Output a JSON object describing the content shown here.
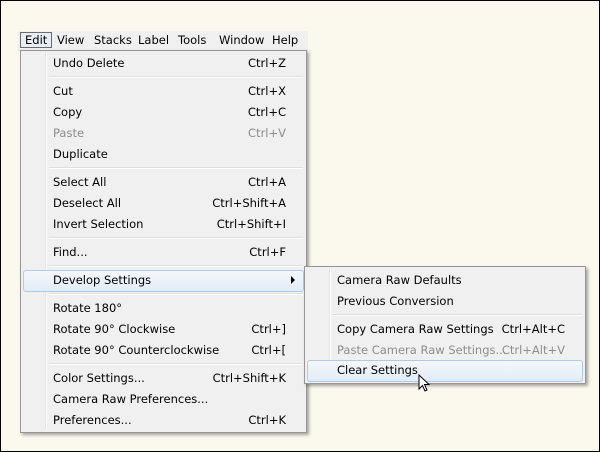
{
  "menubar": {
    "items": [
      "Edit",
      "View",
      "Stacks",
      "Label",
      "Tools",
      "Window",
      "Help"
    ]
  },
  "edit_menu": {
    "undo_delete": {
      "label": "Undo Delete",
      "shortcut": "Ctrl+Z"
    },
    "cut": {
      "label": "Cut",
      "shortcut": "Ctrl+X"
    },
    "copy": {
      "label": "Copy",
      "shortcut": "Ctrl+C"
    },
    "paste": {
      "label": "Paste",
      "shortcut": "Ctrl+V"
    },
    "duplicate": {
      "label": "Duplicate"
    },
    "select_all": {
      "label": "Select All",
      "shortcut": "Ctrl+A"
    },
    "deselect_all": {
      "label": "Deselect All",
      "shortcut": "Ctrl+Shift+A"
    },
    "invert_selection": {
      "label": "Invert Selection",
      "shortcut": "Ctrl+Shift+I"
    },
    "find": {
      "label": "Find...",
      "shortcut": "Ctrl+F"
    },
    "develop_settings": {
      "label": "Develop Settings"
    },
    "rotate_180": {
      "label": "Rotate 180°"
    },
    "rotate_cw": {
      "label": "Rotate 90° Clockwise",
      "shortcut": "Ctrl+]"
    },
    "rotate_ccw": {
      "label": "Rotate 90° Counterclockwise",
      "shortcut": "Ctrl+["
    },
    "color_settings": {
      "label": "Color Settings...",
      "shortcut": "Ctrl+Shift+K"
    },
    "camera_raw_prefs": {
      "label": "Camera Raw Preferences..."
    },
    "preferences": {
      "label": "Preferences...",
      "shortcut": "Ctrl+K"
    }
  },
  "develop_submenu": {
    "camera_raw_defaults": {
      "label": "Camera Raw Defaults"
    },
    "previous_conversion": {
      "label": "Previous Conversion"
    },
    "copy_settings": {
      "label": "Copy Camera Raw Settings",
      "shortcut": "Ctrl+Alt+C"
    },
    "paste_settings": {
      "label": "Paste Camera Raw Settings...",
      "shortcut": "Ctrl+Alt+V"
    },
    "clear_settings": {
      "label": "Clear Settings"
    }
  },
  "colors": {
    "highlight_border": "#aecbea",
    "disabled_text": "#8d8d8d",
    "page_background": "#fbf9ee"
  }
}
